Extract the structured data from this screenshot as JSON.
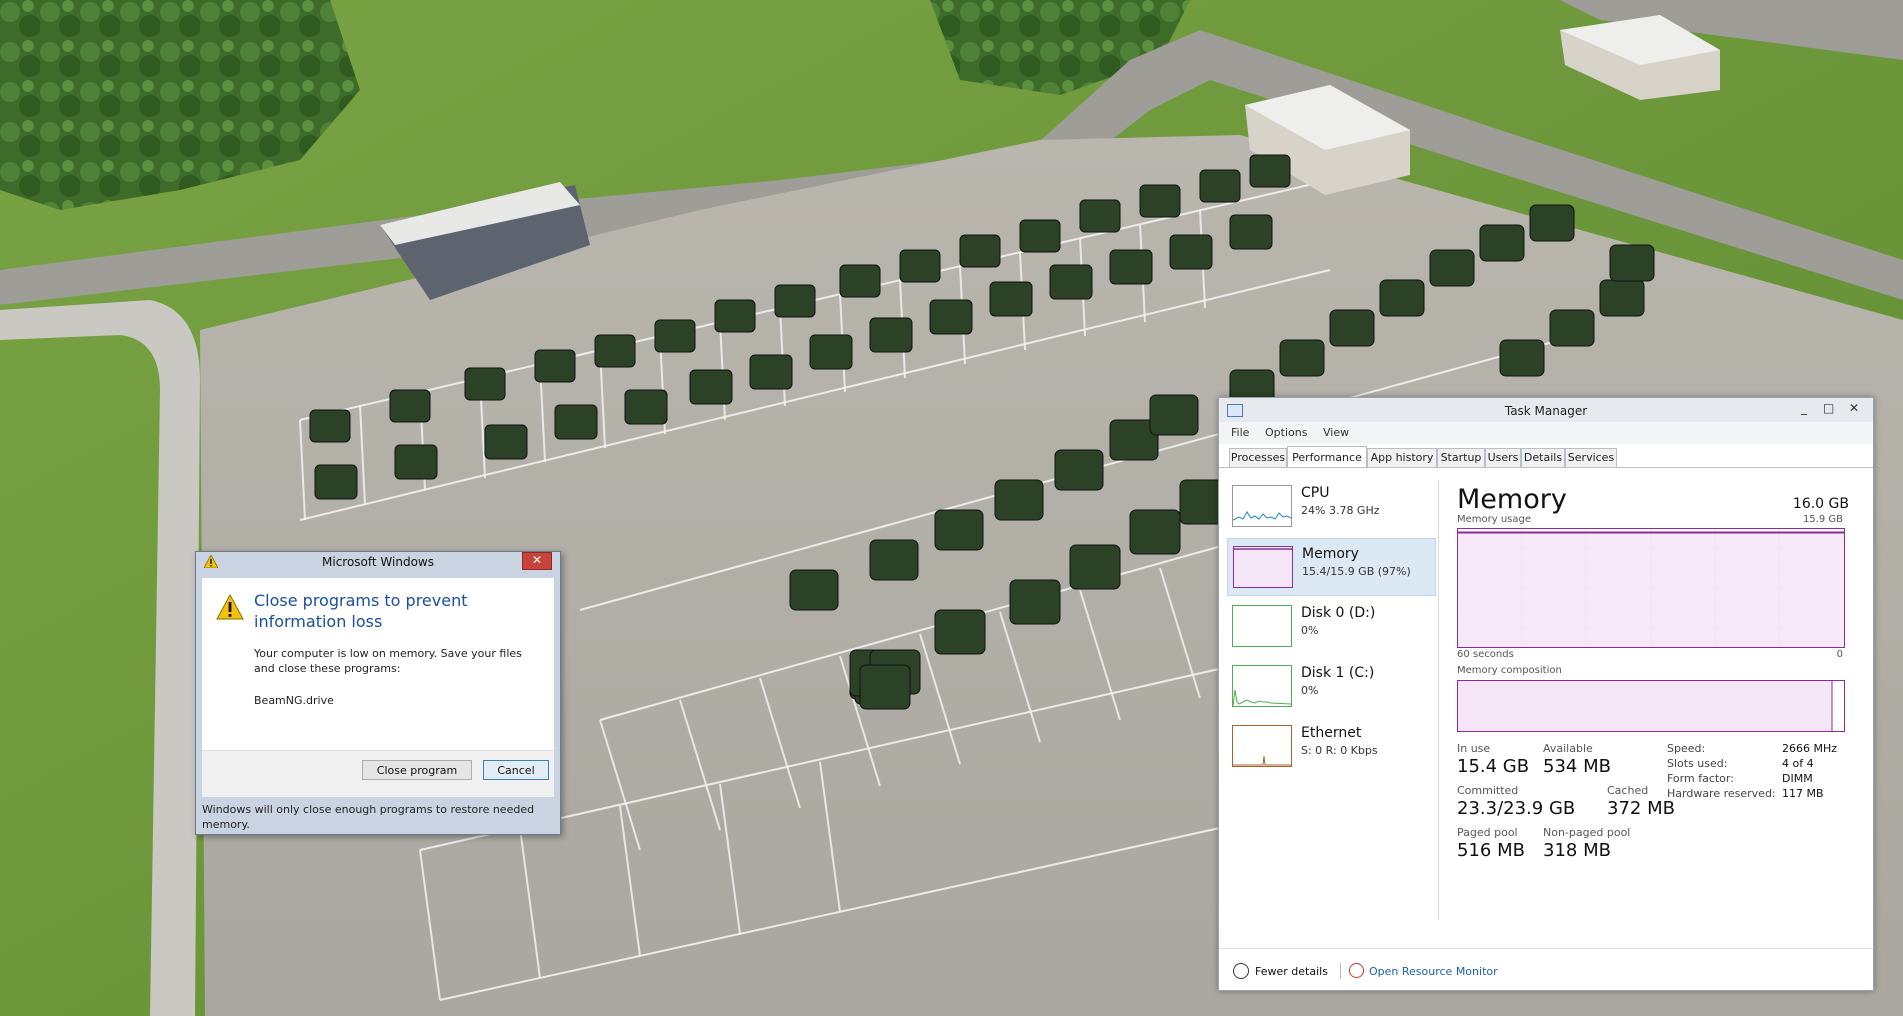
{
  "dialog": {
    "title": "Microsoft Windows",
    "close_glyph": "✕",
    "heading": "Close programs to prevent information loss",
    "message": "Your computer is low on memory. Save your files and close these programs:",
    "program": "BeamNG.drive",
    "close_button": "Close program",
    "cancel_button": "Cancel",
    "footer": "Windows will only close enough programs to restore needed memory.",
    "icon": "warning-icon"
  },
  "taskmanager": {
    "title": "Task Manager",
    "window_controls": {
      "minimize": "_",
      "maximize": "□",
      "close": "✕"
    },
    "menu": [
      "File",
      "Options",
      "View"
    ],
    "tabs": [
      "Processes",
      "Performance",
      "App history",
      "Startup",
      "Users",
      "Details",
      "Services"
    ],
    "active_tab": "Performance",
    "sidebar": [
      {
        "name": "CPU",
        "sub": "24%  3.78 GHz",
        "color": "#1a86c8"
      },
      {
        "name": "Memory",
        "sub": "15.4/15.9 GB (97%)",
        "color": "#8b2a9a"
      },
      {
        "name": "Disk 0 (D:)",
        "sub": "0%",
        "color": "#4caf50"
      },
      {
        "name": "Disk 1 (C:)",
        "sub": "0%",
        "color": "#4caf50"
      },
      {
        "name": "Ethernet",
        "sub": "S: 0  R: 0 Kbps",
        "color": "#b0612a"
      }
    ],
    "main": {
      "title": "Memory",
      "total": "16.0 GB",
      "usage_label": "Memory usage",
      "usage_max": "15.9 GB",
      "time_label": "60 seconds",
      "zero_label": "0",
      "composition_label": "Memory composition",
      "in_use_label": "In use",
      "in_use": "15.4 GB",
      "available_label": "Available",
      "available": "534 MB",
      "committed_label": "Committed",
      "committed": "23.3/23.9 GB",
      "cached_label": "Cached",
      "cached": "372 MB",
      "paged_label": "Paged pool",
      "paged": "516 MB",
      "nonpaged_label": "Non-paged pool",
      "nonpaged": "318 MB",
      "speed_label": "Speed:",
      "speed": "2666 MHz",
      "slots_label": "Slots used:",
      "slots": "4 of 4",
      "form_label": "Form factor:",
      "form": "DIMM",
      "hwres_label": "Hardware reserved:",
      "hwres": "117 MB",
      "usage_fraction": 0.97
    },
    "footer": {
      "fewer": "Fewer details",
      "resource_monitor": "Open Resource Monitor"
    }
  },
  "colors": {
    "accent": "#1a4fa0",
    "memory": "#8b2a9a",
    "grass": "#6d9a3a",
    "asphalt": "#b4b2ab"
  }
}
